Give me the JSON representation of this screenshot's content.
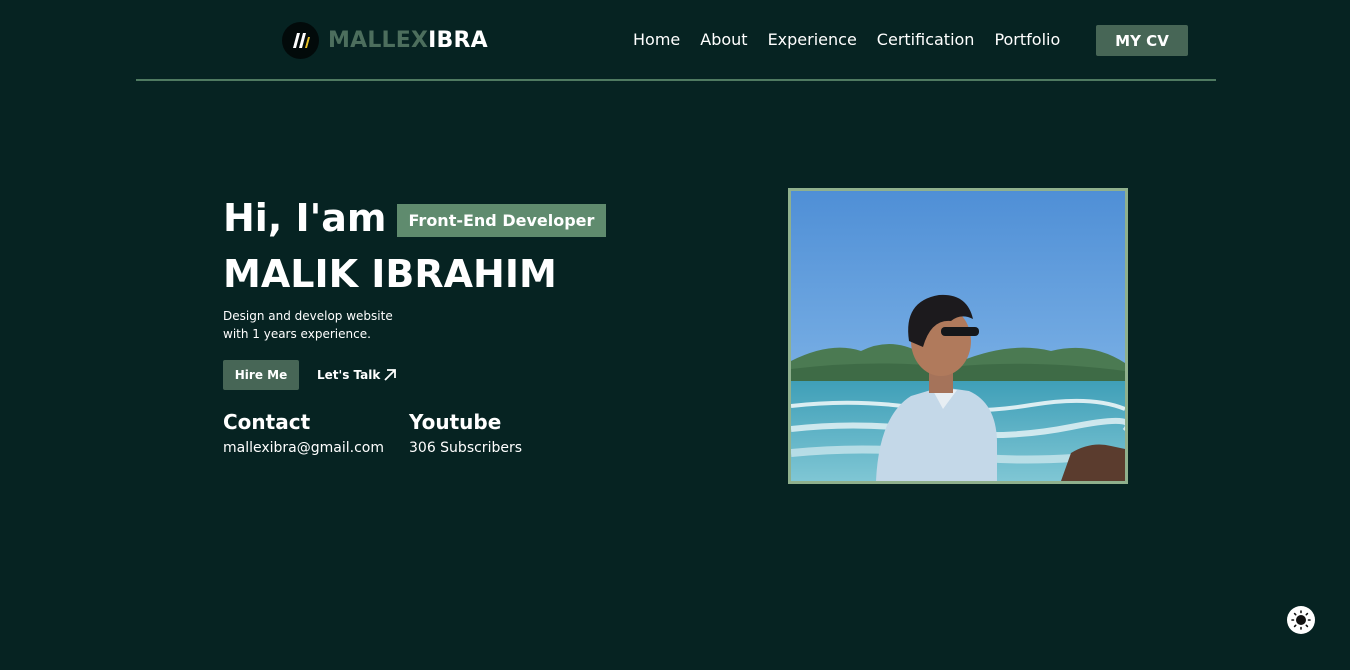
{
  "header": {
    "brand_part1": "MALLEX",
    "brand_part2": "IBRA",
    "logo_icon": "brand-logo-icon",
    "nav": [
      "Home",
      "About",
      "Experience",
      "Certification",
      "Portfolio"
    ],
    "cv_label": "MY CV"
  },
  "hero": {
    "greeting": "Hi, I'am",
    "role": "Front-End Developer",
    "name": "MALIK IBRAHIM",
    "description_line1": "Design and develop website",
    "description_line2": "with 1 years experience.",
    "hire_label": "Hire Me",
    "talk_label": "Let's Talk",
    "talk_icon": "arrow-up-right-icon",
    "contact": {
      "title": "Contact",
      "value": "mallexibra@gmail.com"
    },
    "youtube": {
      "title": "Youtube",
      "value": "306 Subscribers"
    }
  },
  "colors": {
    "background": "#062322",
    "accent": "#476656",
    "badge": "#5f8b6e",
    "photo_border": "#8fb08d"
  },
  "theme_toggle_icon": "sun-icon"
}
